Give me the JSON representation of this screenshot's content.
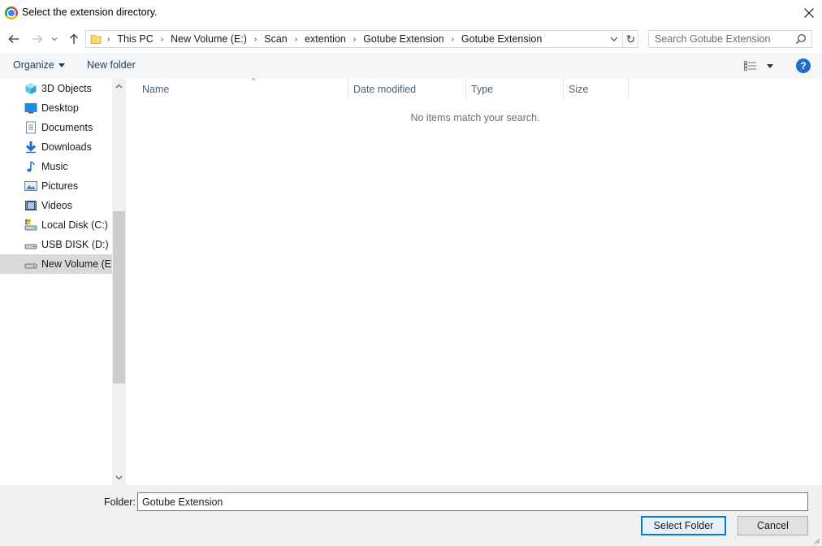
{
  "window": {
    "title": "Select the extension directory."
  },
  "address": {
    "breadcrumbs": [
      "This PC",
      "New Volume (E:)",
      "Scan",
      "extention",
      "Gotube Extension",
      "Gotube Extension"
    ]
  },
  "search": {
    "placeholder": "Search Gotube Extension"
  },
  "commands": {
    "organize": "Organize",
    "new_folder": "New folder"
  },
  "sidebar": {
    "items": [
      {
        "label": "3D Objects",
        "icon": "3d-objects-icon"
      },
      {
        "label": "Desktop",
        "icon": "desktop-icon"
      },
      {
        "label": "Documents",
        "icon": "documents-icon"
      },
      {
        "label": "Downloads",
        "icon": "downloads-icon"
      },
      {
        "label": "Music",
        "icon": "music-icon"
      },
      {
        "label": "Pictures",
        "icon": "pictures-icon"
      },
      {
        "label": "Videos",
        "icon": "videos-icon"
      },
      {
        "label": "Local Disk (C:)",
        "icon": "local-disk-icon"
      },
      {
        "label": "USB DISK (D:)",
        "icon": "usb-drive-icon"
      },
      {
        "label": "New Volume (E:)",
        "icon": "drive-icon",
        "selected": true
      }
    ]
  },
  "filelist": {
    "columns": [
      "Name",
      "Date modified",
      "Type",
      "Size"
    ],
    "empty_message": "No items match your search."
  },
  "footer": {
    "folder_label": "Folder:",
    "folder_value": "Gotube Extension",
    "select_button": "Select Folder",
    "cancel_button": "Cancel"
  },
  "colors": {
    "accent": "#0078d7",
    "command_text": "#1e395b",
    "help_blue": "#1f6fc6"
  }
}
